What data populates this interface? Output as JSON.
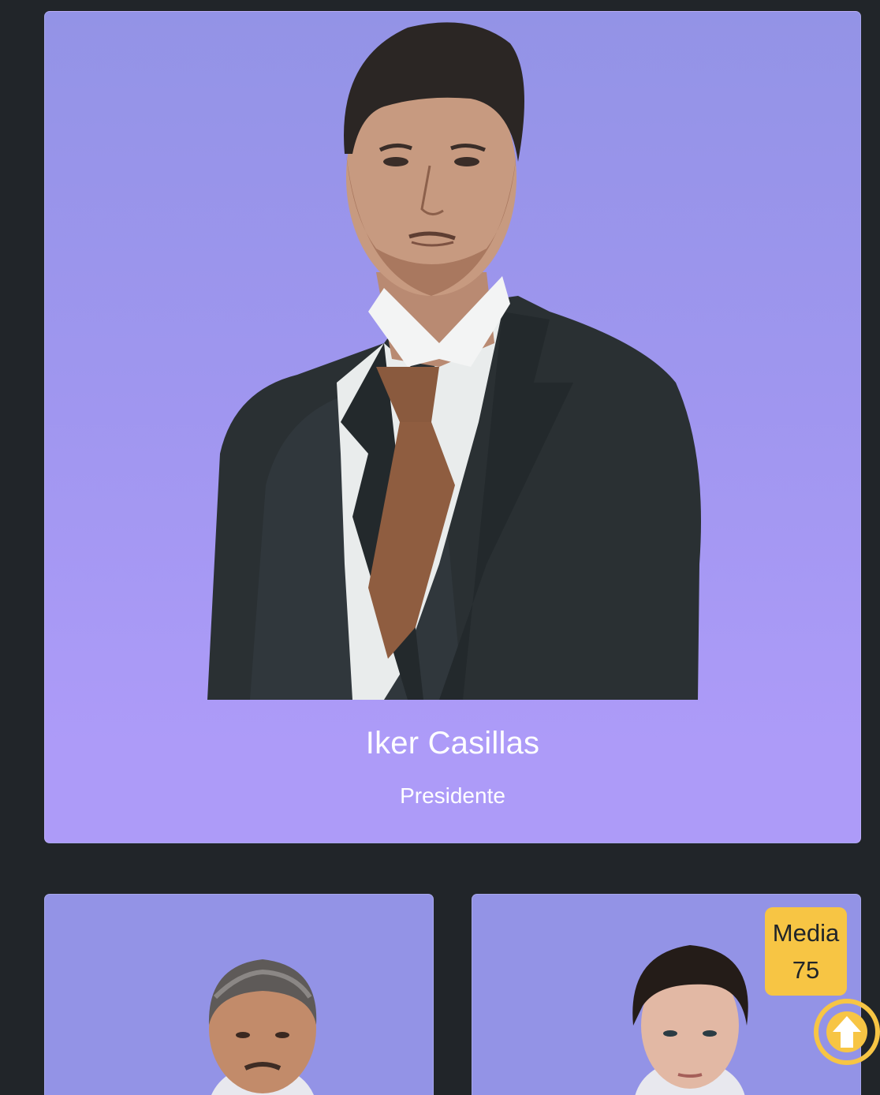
{
  "featured": {
    "name": "Iker Casillas",
    "role": "Presidente"
  },
  "cards": [
    {
      "name": "",
      "role": ""
    },
    {
      "name": "",
      "role": "",
      "media_label": "Media",
      "media_value": "75"
    }
  ],
  "scroll_top": {
    "icon": "arrow-up-icon"
  },
  "colors": {
    "background": "#212529",
    "card": "#9393e6",
    "card_bottom": "#ad9bf8",
    "accent": "#f7c544"
  }
}
